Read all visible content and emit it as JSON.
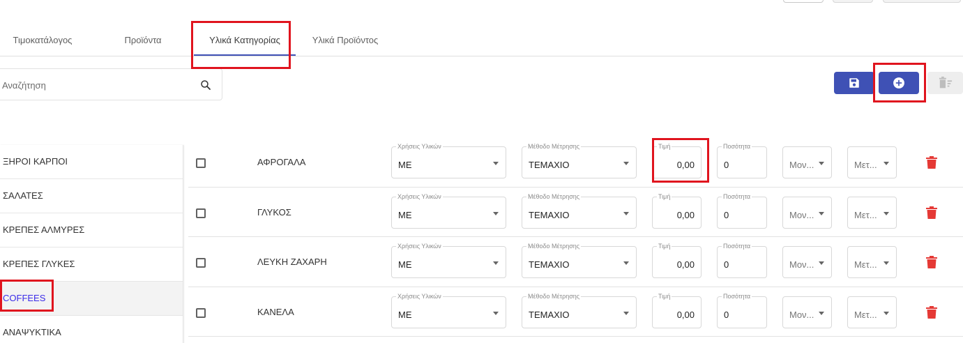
{
  "tabs": [
    {
      "label": "Τιμοκατάλογος"
    },
    {
      "label": "Προϊόντα"
    },
    {
      "label": "Υλικά Κατηγορίας",
      "active": true
    },
    {
      "label": "Υλικά Προϊόντος"
    }
  ],
  "search": {
    "placeholder": "Αναζήτηση",
    "icon": "search-icon"
  },
  "toolbar": {
    "save_icon": "save-icon",
    "add_icon": "add-circle-icon",
    "delete_icon": "delete-sweep-icon"
  },
  "categories": [
    {
      "label": "ΞΗΡΟΙ ΚΑΡΠΟΙ"
    },
    {
      "label": "ΣΑΛΑΤΕΣ"
    },
    {
      "label": "ΚΡΕΠΕΣ ΑΛΜΥΡΕΣ"
    },
    {
      "label": "ΚΡΕΠΕΣ ΓΛΥΚΕΣ"
    },
    {
      "label": "COFFEES",
      "selected": true
    },
    {
      "label": "ΑΝΑΨΥΚΤΙΚΑ"
    }
  ],
  "field_labels": {
    "uses": "Χρήσεις Υλικών",
    "measure": "Μέθοδο Μέτρησης",
    "price": "Τιμή",
    "quantity": "Ποσότητα"
  },
  "rows": [
    {
      "name": "ΑΦΡΟΓΑΛΑ",
      "uses": "ΜΕ",
      "measure": "ΤΕΜΑΧΙΟ",
      "price": "0,00",
      "quantity": "0",
      "unit1": "Μον...",
      "unit2": "Μετ..."
    },
    {
      "name": "ΓΛΥΚΟΣ",
      "uses": "ΜΕ",
      "measure": "ΤΕΜΑΧΙΟ",
      "price": "0,00",
      "quantity": "0",
      "unit1": "Μον...",
      "unit2": "Μετ..."
    },
    {
      "name": "ΛΕΥΚΗ ΖΑΧΑΡΗ",
      "uses": "ΜΕ",
      "measure": "ΤΕΜΑΧΙΟ",
      "price": "0,00",
      "quantity": "0",
      "unit1": "Μον...",
      "unit2": "Μετ..."
    },
    {
      "name": "ΚΑΝΕΛΑ",
      "uses": "ΜΕ",
      "measure": "ΤΕΜΑΧΙΟ",
      "price": "0,00",
      "quantity": "0",
      "unit1": "Μον...",
      "unit2": "Μετ..."
    }
  ],
  "colors": {
    "accent": "#3f51b5",
    "danger": "#e53935",
    "highlight": "#e0141e",
    "selected_text": "#3b2be8"
  }
}
